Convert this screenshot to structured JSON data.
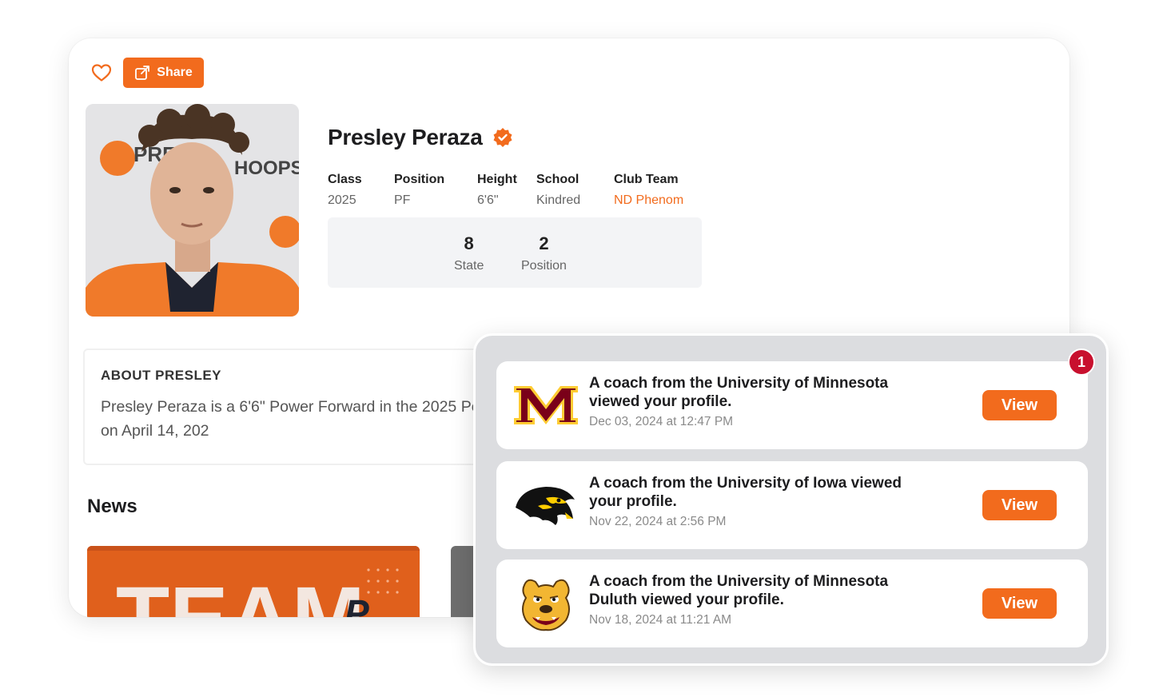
{
  "colors": {
    "accent": "#f26b1d",
    "badge": "#c8102e",
    "verified": "#f26b1d"
  },
  "profile": {
    "share_label": "Share",
    "name": "Presley Peraza",
    "stats": [
      {
        "label": "Class",
        "value": "2025"
      },
      {
        "label": "Position",
        "value": "PF"
      },
      {
        "label": "Height",
        "value": "6'6\""
      },
      {
        "label": "School",
        "value": "Kindred"
      },
      {
        "label": "Club Team",
        "value": "ND Phenom"
      }
    ],
    "rankings": [
      {
        "value": "8",
        "label": "State"
      },
      {
        "value": "2",
        "label": "Position"
      }
    ],
    "photo_brand": [
      "PREP",
      "HOOPS"
    ]
  },
  "about": {
    "title": "ABOUT PRESLEY",
    "text": "Presley Peraza is a 6'6\" Power Forward in the 2025 Peraza's Player Profile was created on April 14, 202"
  },
  "news": {
    "title": "News",
    "thumb_text": "TEAM",
    "thumb_logo": "P"
  },
  "notifications": {
    "badge_count": "1",
    "items": [
      {
        "message": "A coach from the University of Minnesota viewed your profile.",
        "time": "Dec 03, 2024 at 12:47 PM",
        "button": "View",
        "logo": "minnesota-m-logo"
      },
      {
        "message": "A coach from the University of Iowa viewed your profile.",
        "time": "Nov 22, 2024 at 2:56 PM",
        "button": "View",
        "logo": "iowa-hawkeye-logo"
      },
      {
        "message": "A coach from the University of Minnesota Duluth viewed your profile.",
        "time": "Nov 18, 2024 at 11:21 AM",
        "button": "View",
        "logo": "umd-bulldog-logo"
      }
    ]
  }
}
